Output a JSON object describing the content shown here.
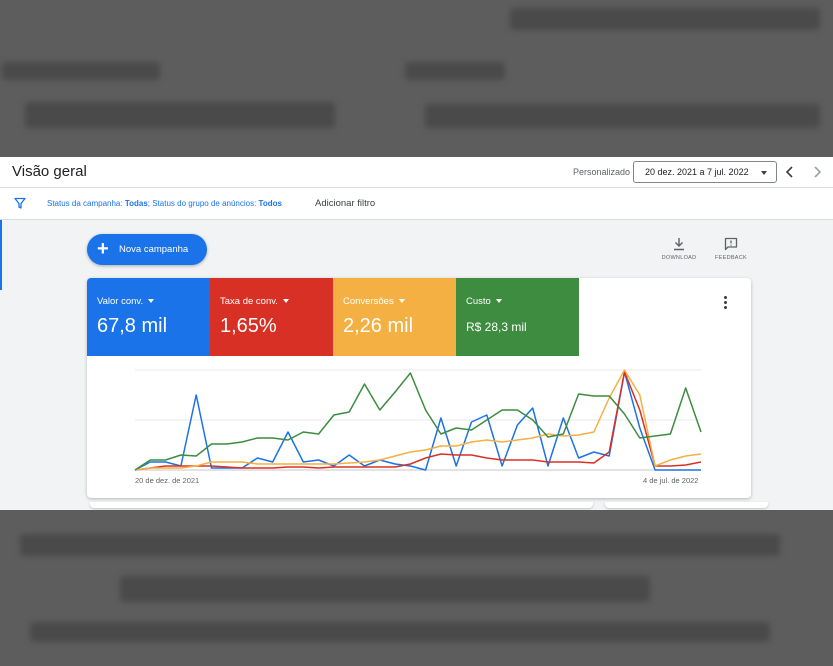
{
  "header": {
    "title": "Visão geral",
    "range_label": "Personalizado",
    "range_value": "20 dez. 2021 a 7 jul. 2022"
  },
  "filter": {
    "campaign_status_label": "Status da campanha: ",
    "campaign_status_value": "Todas",
    "adgroup_status_label": "; Status do grupo de anúncios: ",
    "adgroup_status_value": "Todos",
    "add_filter": "Adicionar filtro"
  },
  "actions": {
    "new_campaign": "Nova campanha",
    "download": "DOWNLOAD",
    "feedback": "FEEDBACK"
  },
  "metrics": [
    {
      "name": "Valor conv.",
      "value": "67,8 mil",
      "color": "#1a73e8"
    },
    {
      "name": "Taxa de conv.",
      "value": "1,65%",
      "color": "#d93025"
    },
    {
      "name": "Conversões",
      "value": "2,26 mil",
      "color": "#f4b042"
    },
    {
      "name": "Custo",
      "value": "R$ 28,3 mil",
      "color": "#3d8c40"
    }
  ],
  "chart_data": {
    "type": "line",
    "x_start_label": "20 de dez. de 2021",
    "x_end_label": "4 de jul. de 2022",
    "ylim": [
      0,
      100
    ],
    "grid": true,
    "series": [
      {
        "color": "#1a73e8",
        "values": [
          0,
          8,
          8,
          4,
          75,
          2,
          2,
          2,
          12,
          8,
          38,
          8,
          10,
          4,
          15,
          4,
          10,
          6,
          4,
          0,
          52,
          4,
          48,
          55,
          4,
          45,
          62,
          4,
          52,
          12,
          18,
          14,
          98,
          42,
          0,
          0,
          0,
          0
        ]
      },
      {
        "color": "#d93025",
        "values": [
          0,
          2,
          4,
          4,
          4,
          4,
          3,
          2,
          2,
          2,
          3,
          3,
          2,
          3,
          3,
          3,
          3,
          3,
          6,
          12,
          16,
          15,
          15,
          12,
          10,
          10,
          10,
          8,
          8,
          8,
          7,
          18,
          98,
          60,
          4,
          4,
          5,
          8
        ]
      },
      {
        "color": "#f4b042",
        "values": [
          0,
          2,
          2,
          2,
          4,
          8,
          8,
          8,
          6,
          6,
          6,
          6,
          6,
          6,
          7,
          8,
          10,
          14,
          18,
          20,
          24,
          24,
          28,
          30,
          28,
          30,
          32,
          36,
          34,
          35,
          38,
          72,
          100,
          75,
          4,
          10,
          14,
          16
        ]
      },
      {
        "color": "#3d8c40",
        "values": [
          0,
          10,
          10,
          15,
          14,
          26,
          26,
          28,
          32,
          32,
          30,
          38,
          36,
          55,
          58,
          86,
          60,
          78,
          97,
          60,
          36,
          42,
          40,
          50,
          60,
          60,
          50,
          33,
          36,
          76,
          74,
          74,
          56,
          32,
          34,
          36,
          82,
          38
        ]
      }
    ]
  }
}
